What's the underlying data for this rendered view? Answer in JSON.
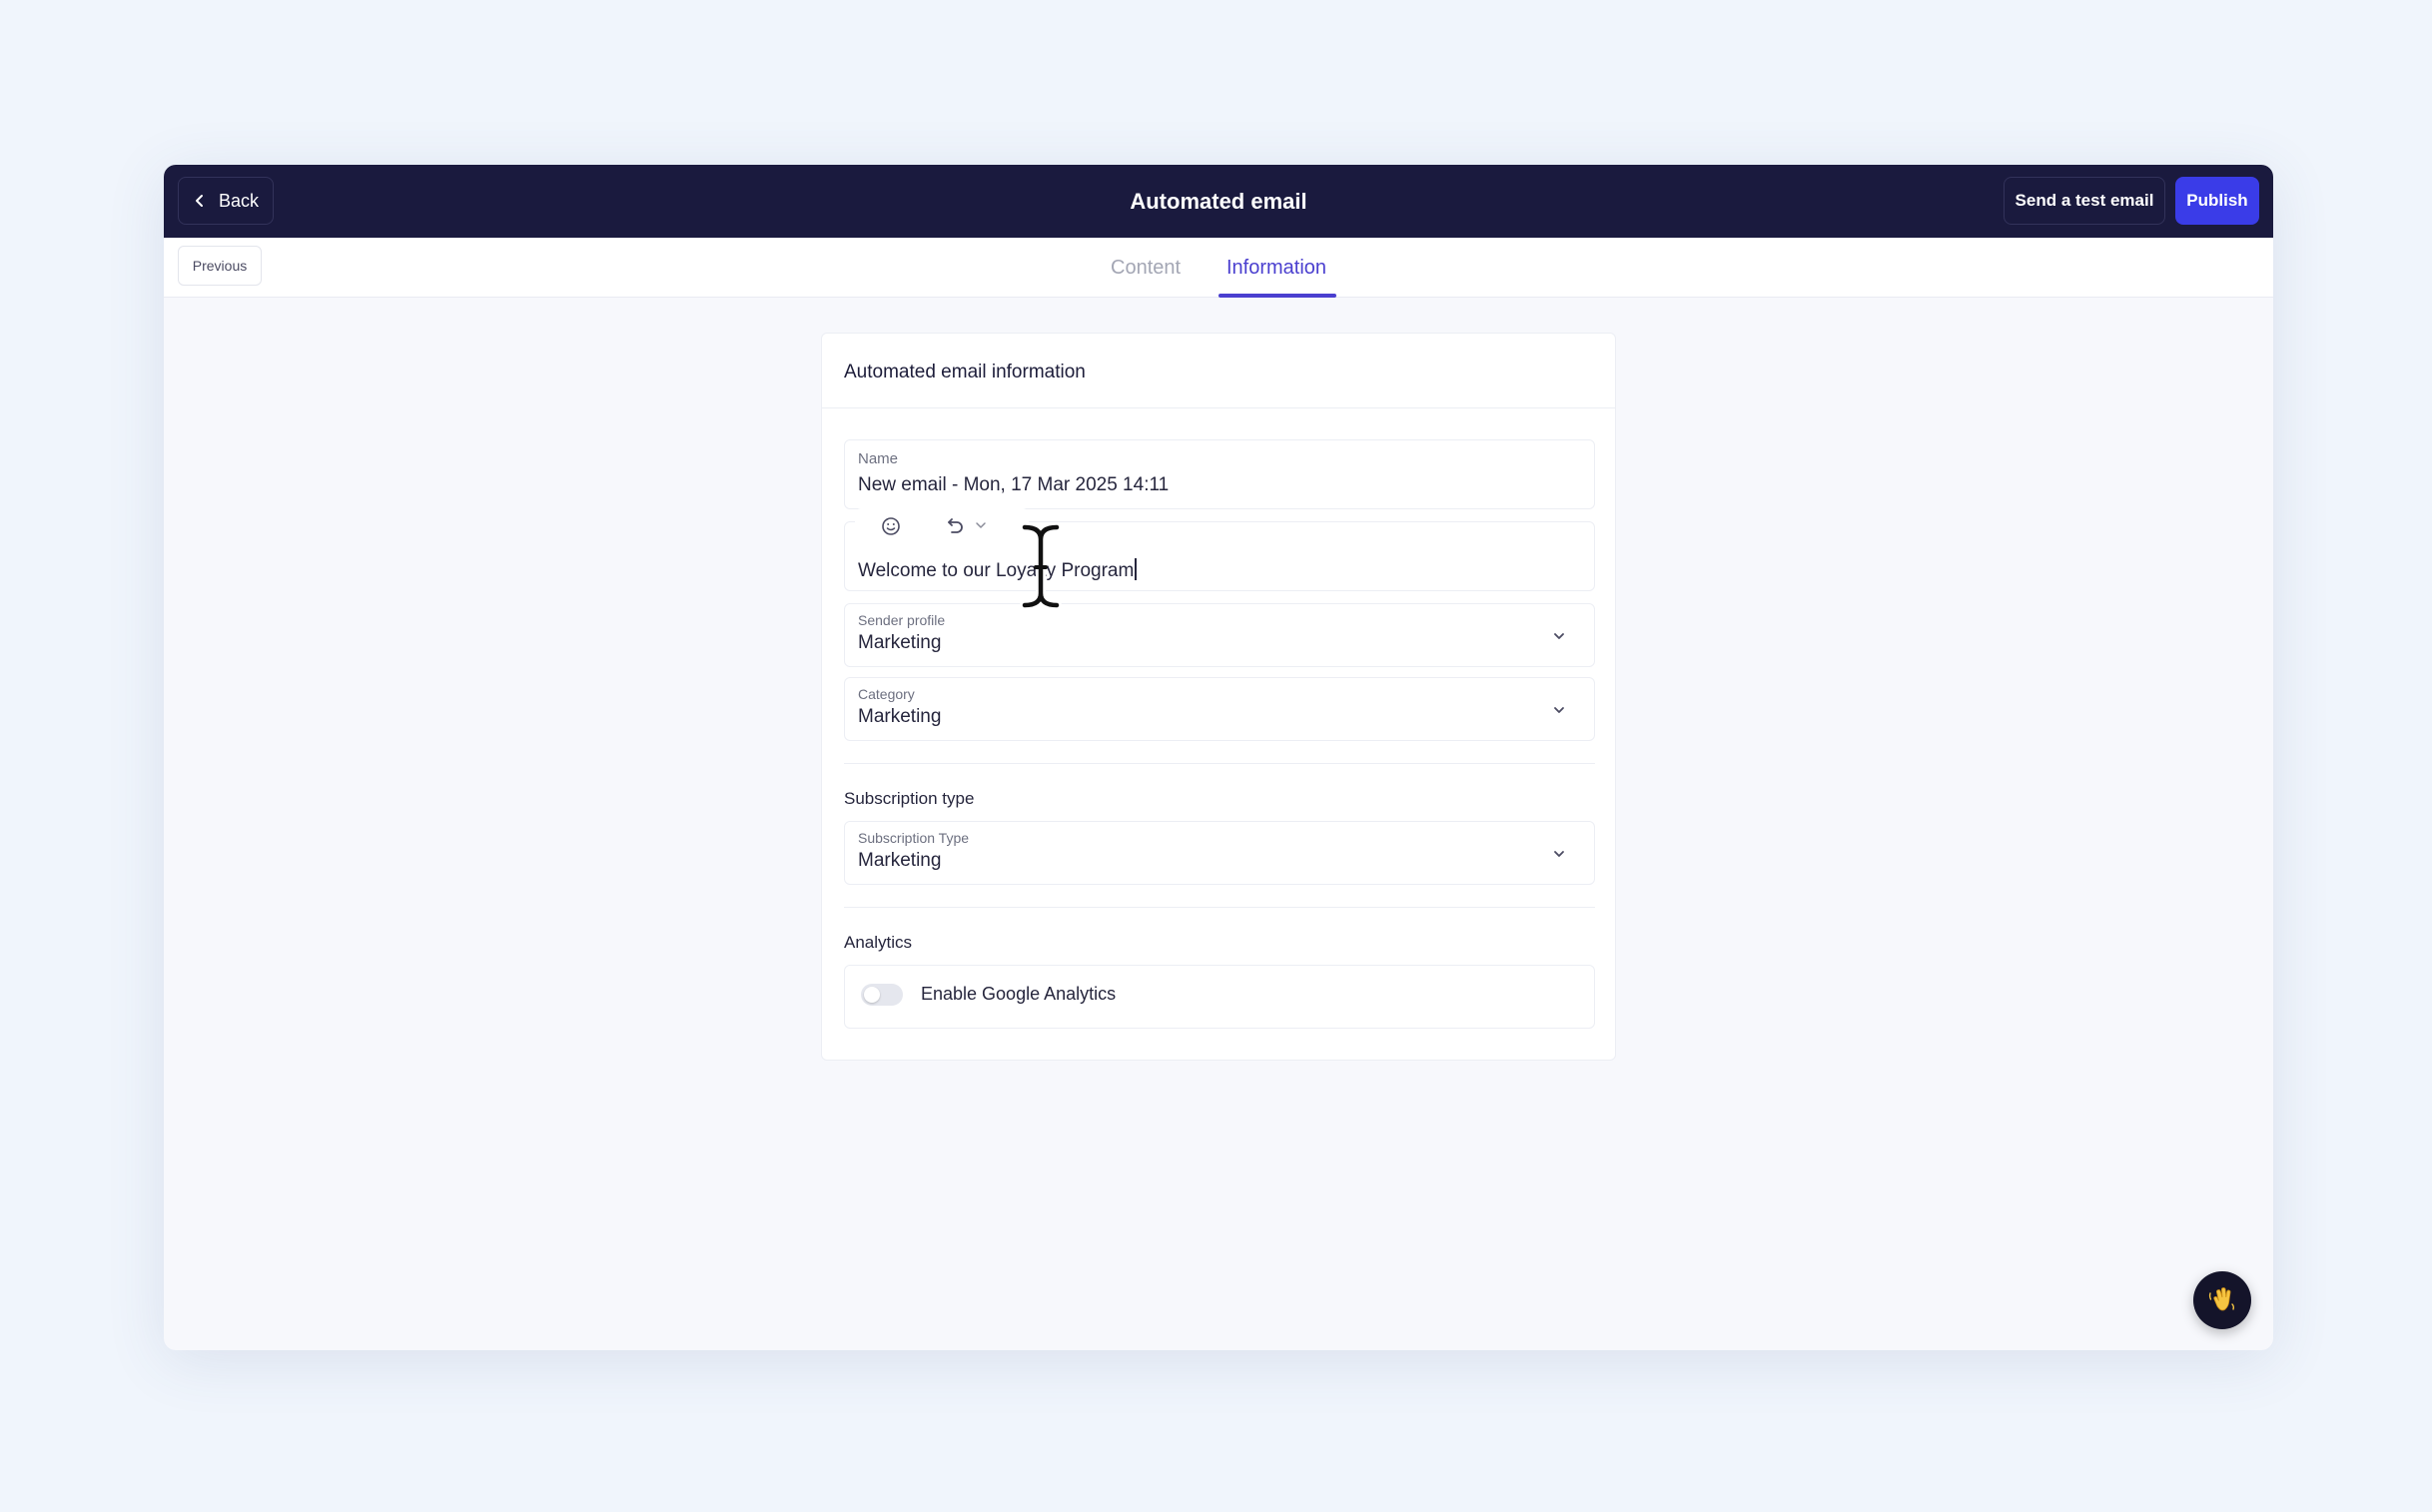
{
  "header": {
    "back_label": "Back",
    "title": "Automated email",
    "test_email_label": "Send a test email",
    "publish_label": "Publish"
  },
  "tabbar": {
    "previous_label": "Previous",
    "tabs": [
      {
        "label": "Content",
        "active": false
      },
      {
        "label": "Information",
        "active": true
      }
    ]
  },
  "card": {
    "title": "Automated email information",
    "name_field": {
      "label": "Name",
      "value": "New email - Mon, 17 Mar 2025 14:11"
    },
    "subject_field": {
      "value": "Welcome to our Loyalty Program"
    },
    "sender_profile": {
      "label": "Sender profile",
      "value": "Marketing"
    },
    "category": {
      "label": "Category",
      "value": "Marketing"
    },
    "subscription_section": {
      "title": "Subscription type",
      "field_label": "Subscription Type",
      "value": "Marketing"
    },
    "analytics_section": {
      "title": "Analytics",
      "toggle_label": "Enable Google Analytics",
      "enabled": false
    }
  },
  "colors": {
    "header_bg": "#1a1a3e",
    "accent": "#4a3fcf",
    "publish_bg": "#3a3ce8",
    "page_bg": "#f0f5fc"
  },
  "icons": {
    "back": "chevron-left-icon",
    "emoji": "smiley-icon",
    "personalize": "loop-arrow-icon",
    "dropdown": "chevron-down-icon",
    "help": "waving-hand-icon"
  }
}
